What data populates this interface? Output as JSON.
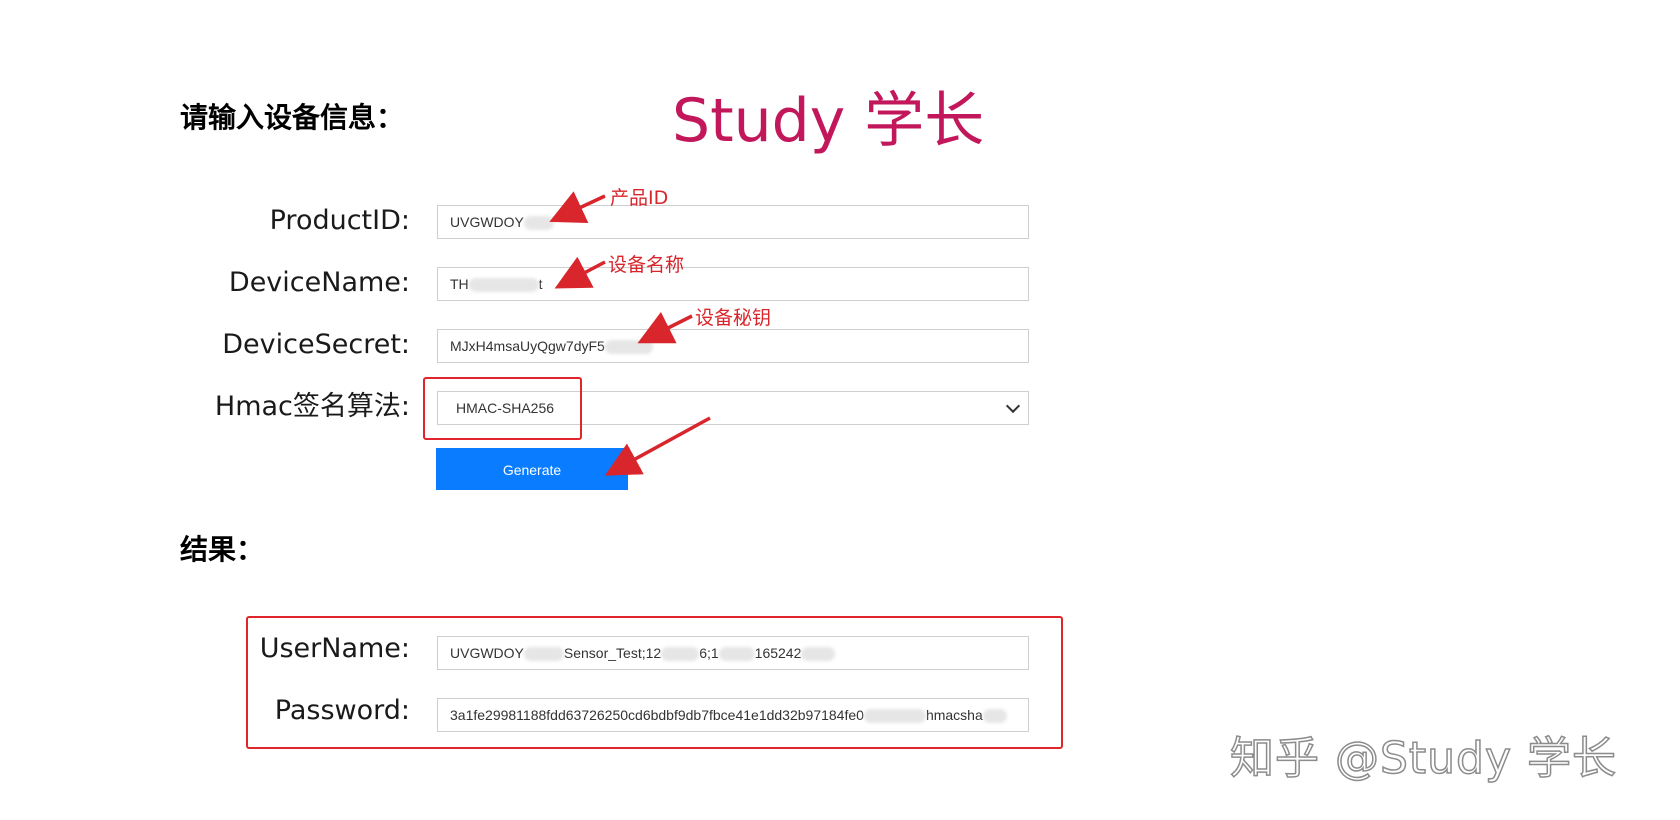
{
  "headings": {
    "input_title": "请输入设备信息：",
    "result_title": "结果："
  },
  "brand": {
    "text": "Study 学长",
    "color": "#c2185b"
  },
  "form": {
    "product_id": {
      "label": "ProductID:",
      "value_visible": "UVGWDOY"
    },
    "device_name": {
      "label": "DeviceName:",
      "value_prefix": "TH",
      "value_suffix": "t"
    },
    "device_secret": {
      "label": "DeviceSecret:",
      "value_visible": "MJxH4msaUyQgw7dyF5"
    },
    "hmac": {
      "label": "Hmac签名算法:",
      "selected": "HMAC-SHA256"
    },
    "generate_button": "Generate"
  },
  "results": {
    "username": {
      "label": "UserName:",
      "part1": "UVGWDOY",
      "part2": "Sensor_Test;12",
      "part3": "6;1",
      "part4": "165242"
    },
    "password": {
      "label": "Password:",
      "part1": "3a1fe29981188fdd63726250cd6bdbf9db7fbce41e1dd32b97184fe0",
      "part2": "hmacsha"
    }
  },
  "annotations": {
    "product_id": "产品ID",
    "device_name": "设备名称",
    "device_secret": "设备秘钥",
    "color": "#d8262c"
  },
  "watermark": "知乎 @Study 学长",
  "colors": {
    "button_bg": "#0a7cff",
    "highlight_box": "#e0262a"
  }
}
